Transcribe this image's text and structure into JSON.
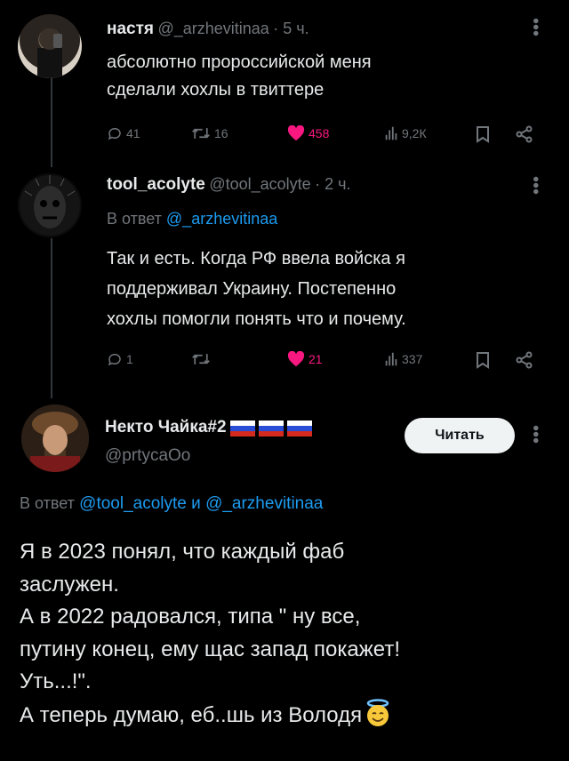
{
  "tweet1": {
    "name": "настя",
    "handle": "@_arzhevitinaa",
    "time": "· 5 ч.",
    "text_line1": "абсолютно пророссийской меня",
    "text_line2": "сделали хохлы в твиттере",
    "replies": "41",
    "retweets": "16",
    "likes": "458",
    "views": "9,2К"
  },
  "tweet2": {
    "name": "tool_acolyte",
    "handle": "@tool_acolyte",
    "time": "· 2 ч.",
    "reply_prefix": "В ответ",
    "reply_to": "@_arzhevitinaa",
    "text_line1": "Так и есть. Когда РФ ввела войска я",
    "text_line2": "поддерживал Украину. Постепенно",
    "text_line3": "хохлы помогли понять что и почему.",
    "replies": "1",
    "retweets": "",
    "likes": "21",
    "views": "337"
  },
  "tweet3": {
    "name": "Некто Чайка#2",
    "handle": "@prtycaOo",
    "follow_label": "Читать",
    "reply_prefix": "В ответ",
    "reply_to1": "@tool_acolyte",
    "reply_and": "и",
    "reply_to2": "@_arzhevitinaa",
    "lines": [
      "Я в 2023 понял, что каждый фаб",
      "заслужен.",
      "А в 2022 радовался, типа \" ну все,",
      "путину конец, ему щас запад покажет!",
      "Уть...!\".",
      "А теперь думаю, еб..шь из Володя"
    ]
  },
  "colors": {
    "link": "#1d9bf0",
    "like": "#f91880",
    "muted": "#71767b",
    "text": "#e7e9ea"
  }
}
